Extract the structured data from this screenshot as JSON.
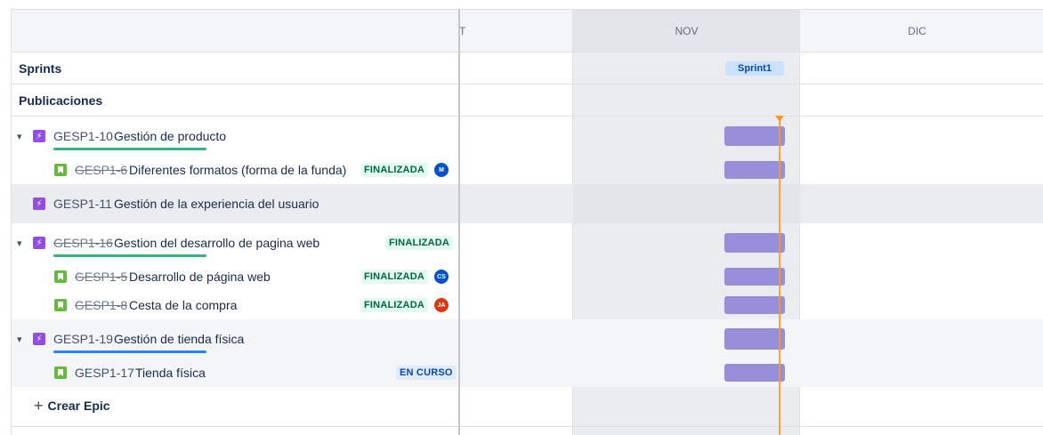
{
  "timeline": {
    "months": [
      "T",
      "NOV",
      "DIC"
    ],
    "today_color": "#ff991f"
  },
  "rows": {
    "sprints_label": "Sprints",
    "sprint_chip": "Sprint1",
    "releases_label": "Publicaciones"
  },
  "issues": [
    {
      "type": "epic",
      "key": "GESP1-10",
      "summary": "Gestión de producto",
      "done": false,
      "status": "",
      "progress_color": "#36b37e"
    },
    {
      "type": "story",
      "key": "GESP1-6",
      "summary": "Diferentes formatos (forma de la funda)",
      "done": true,
      "status": "FINALIZADA",
      "avatar": "M",
      "avatar_color": "#0052cc"
    },
    {
      "type": "epic",
      "key": "GESP1-11",
      "summary": "Gestión de la experiencia del usuario",
      "done": false,
      "status": ""
    },
    {
      "type": "epic",
      "key": "GESP1-16",
      "summary": "Gestion del desarrollo de pagina web",
      "done": true,
      "status": "FINALIZADA",
      "progress_color": "#36b37e"
    },
    {
      "type": "story",
      "key": "GESP1-5",
      "summary": "Desarrollo de página web",
      "done": true,
      "status": "FINALIZADA",
      "avatar": "CS",
      "avatar_color": "#0052cc"
    },
    {
      "type": "story",
      "key": "GESP1-8",
      "summary": "Cesta de la compra",
      "done": true,
      "status": "FINALIZADA",
      "avatar": "JA",
      "avatar_color": "#de350b"
    },
    {
      "type": "epic",
      "key": "GESP1-19",
      "summary": "Gestión de tienda física",
      "done": false,
      "status": "",
      "progress_color": "#2684ff"
    },
    {
      "type": "story",
      "key": "GESP1-17",
      "summary": "Tienda física",
      "done": false,
      "status": "EN CURSO"
    }
  ],
  "create_epic_label": "Crear Epic",
  "icons": {
    "chevron": "▾",
    "epic": "⚡",
    "plus": "+"
  },
  "colors": {
    "epic_bar": "#998dd9",
    "epic_icon": "#904ee2",
    "story_icon": "#63ba3c"
  }
}
